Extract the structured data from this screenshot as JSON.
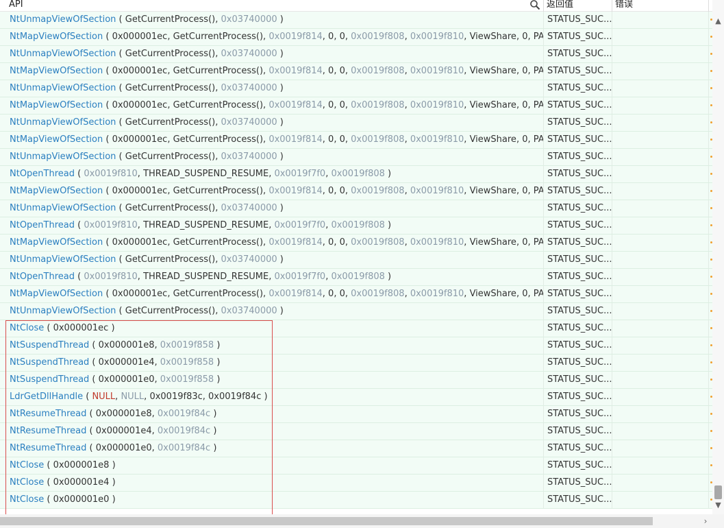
{
  "header": {
    "api_label": "API",
    "return_label": "返回值",
    "error_label": "错误",
    "more_label": "⋮",
    "search_icon": "search-icon"
  },
  "colors": {
    "function": "#2b7fc0",
    "address": "#8a9aa8",
    "null_first": "#c0392b",
    "row_bg": "#f2fcf6",
    "highlight": "#d94c4c"
  },
  "rows": [
    {
      "fn": "NtUnmapViewOfSection",
      "args": [
        {
          "t": "GetCurrentProcess()",
          "k": "plain"
        },
        {
          "t": "0x03740000",
          "k": "addr"
        }
      ],
      "ret": "STATUS_SUC..."
    },
    {
      "fn": "NtMapViewOfSection",
      "args": [
        {
          "t": "0x000001ec",
          "k": "plain"
        },
        {
          "t": "GetCurrentProcess()",
          "k": "plain"
        },
        {
          "t": "0x0019f814",
          "k": "addr"
        },
        {
          "t": "0",
          "k": "plain"
        },
        {
          "t": "0",
          "k": "plain"
        },
        {
          "t": "0x0019f808",
          "k": "addr"
        },
        {
          "t": "0x0019f810",
          "k": "addr"
        },
        {
          "t": "ViewShare",
          "k": "plain"
        },
        {
          "t": "0",
          "k": "plain"
        },
        {
          "t": "PAGE_R...",
          "k": "plain"
        }
      ],
      "ret": "STATUS_SUC...",
      "nocl": true
    },
    {
      "fn": "NtUnmapViewOfSection",
      "args": [
        {
          "t": "GetCurrentProcess()",
          "k": "plain"
        },
        {
          "t": "0x03740000",
          "k": "addr"
        }
      ],
      "ret": "STATUS_SUC..."
    },
    {
      "fn": "NtMapViewOfSection",
      "args": [
        {
          "t": "0x000001ec",
          "k": "plain"
        },
        {
          "t": "GetCurrentProcess()",
          "k": "plain"
        },
        {
          "t": "0x0019f814",
          "k": "addr"
        },
        {
          "t": "0",
          "k": "plain"
        },
        {
          "t": "0",
          "k": "plain"
        },
        {
          "t": "0x0019f808",
          "k": "addr"
        },
        {
          "t": "0x0019f810",
          "k": "addr"
        },
        {
          "t": "ViewShare",
          "k": "plain"
        },
        {
          "t": "0",
          "k": "plain"
        },
        {
          "t": "PAGE_R...",
          "k": "plain"
        }
      ],
      "ret": "STATUS_SUC...",
      "nocl": true
    },
    {
      "fn": "NtUnmapViewOfSection",
      "args": [
        {
          "t": "GetCurrentProcess()",
          "k": "plain"
        },
        {
          "t": "0x03740000",
          "k": "addr"
        }
      ],
      "ret": "STATUS_SUC..."
    },
    {
      "fn": "NtMapViewOfSection",
      "args": [
        {
          "t": "0x000001ec",
          "k": "plain"
        },
        {
          "t": "GetCurrentProcess()",
          "k": "plain"
        },
        {
          "t": "0x0019f814",
          "k": "addr"
        },
        {
          "t": "0",
          "k": "plain"
        },
        {
          "t": "0",
          "k": "plain"
        },
        {
          "t": "0x0019f808",
          "k": "addr"
        },
        {
          "t": "0x0019f810",
          "k": "addr"
        },
        {
          "t": "ViewShare",
          "k": "plain"
        },
        {
          "t": "0",
          "k": "plain"
        },
        {
          "t": "PAGE_R...",
          "k": "plain"
        }
      ],
      "ret": "STATUS_SUC...",
      "nocl": true
    },
    {
      "fn": "NtUnmapViewOfSection",
      "args": [
        {
          "t": "GetCurrentProcess()",
          "k": "plain"
        },
        {
          "t": "0x03740000",
          "k": "addr"
        }
      ],
      "ret": "STATUS_SUC..."
    },
    {
      "fn": "NtMapViewOfSection",
      "args": [
        {
          "t": "0x000001ec",
          "k": "plain"
        },
        {
          "t": "GetCurrentProcess()",
          "k": "plain"
        },
        {
          "t": "0x0019f814",
          "k": "addr"
        },
        {
          "t": "0",
          "k": "plain"
        },
        {
          "t": "0",
          "k": "plain"
        },
        {
          "t": "0x0019f808",
          "k": "addr"
        },
        {
          "t": "0x0019f810",
          "k": "addr"
        },
        {
          "t": "ViewShare",
          "k": "plain"
        },
        {
          "t": "0",
          "k": "plain"
        },
        {
          "t": "PAGE_R...",
          "k": "plain"
        }
      ],
      "ret": "STATUS_SUC...",
      "nocl": true
    },
    {
      "fn": "NtUnmapViewOfSection",
      "args": [
        {
          "t": "GetCurrentProcess()",
          "k": "plain"
        },
        {
          "t": "0x03740000",
          "k": "addr"
        }
      ],
      "ret": "STATUS_SUC..."
    },
    {
      "fn": "NtOpenThread",
      "args": [
        {
          "t": "0x0019f810",
          "k": "addr"
        },
        {
          "t": "THREAD_SUSPEND_RESUME",
          "k": "plain"
        },
        {
          "t": "0x0019f7f0",
          "k": "addr"
        },
        {
          "t": "0x0019f808",
          "k": "addr"
        }
      ],
      "ret": "STATUS_SUC..."
    },
    {
      "fn": "NtMapViewOfSection",
      "args": [
        {
          "t": "0x000001ec",
          "k": "plain"
        },
        {
          "t": "GetCurrentProcess()",
          "k": "plain"
        },
        {
          "t": "0x0019f814",
          "k": "addr"
        },
        {
          "t": "0",
          "k": "plain"
        },
        {
          "t": "0",
          "k": "plain"
        },
        {
          "t": "0x0019f808",
          "k": "addr"
        },
        {
          "t": "0x0019f810",
          "k": "addr"
        },
        {
          "t": "ViewShare",
          "k": "plain"
        },
        {
          "t": "0",
          "k": "plain"
        },
        {
          "t": "PAGE_R...",
          "k": "plain"
        }
      ],
      "ret": "STATUS_SUC...",
      "nocl": true
    },
    {
      "fn": "NtUnmapViewOfSection",
      "args": [
        {
          "t": "GetCurrentProcess()",
          "k": "plain"
        },
        {
          "t": "0x03740000",
          "k": "addr"
        }
      ],
      "ret": "STATUS_SUC..."
    },
    {
      "fn": "NtOpenThread",
      "args": [
        {
          "t": "0x0019f810",
          "k": "addr"
        },
        {
          "t": "THREAD_SUSPEND_RESUME",
          "k": "plain"
        },
        {
          "t": "0x0019f7f0",
          "k": "addr"
        },
        {
          "t": "0x0019f808",
          "k": "addr"
        }
      ],
      "ret": "STATUS_SUC..."
    },
    {
      "fn": "NtMapViewOfSection",
      "args": [
        {
          "t": "0x000001ec",
          "k": "plain"
        },
        {
          "t": "GetCurrentProcess()",
          "k": "plain"
        },
        {
          "t": "0x0019f814",
          "k": "addr"
        },
        {
          "t": "0",
          "k": "plain"
        },
        {
          "t": "0",
          "k": "plain"
        },
        {
          "t": "0x0019f808",
          "k": "addr"
        },
        {
          "t": "0x0019f810",
          "k": "addr"
        },
        {
          "t": "ViewShare",
          "k": "plain"
        },
        {
          "t": "0",
          "k": "plain"
        },
        {
          "t": "PAGE_R...",
          "k": "plain"
        }
      ],
      "ret": "STATUS_SUC...",
      "nocl": true
    },
    {
      "fn": "NtUnmapViewOfSection",
      "args": [
        {
          "t": "GetCurrentProcess()",
          "k": "plain"
        },
        {
          "t": "0x03740000",
          "k": "addr"
        }
      ],
      "ret": "STATUS_SUC..."
    },
    {
      "fn": "NtOpenThread",
      "args": [
        {
          "t": "0x0019f810",
          "k": "addr"
        },
        {
          "t": "THREAD_SUSPEND_RESUME",
          "k": "plain"
        },
        {
          "t": "0x0019f7f0",
          "k": "addr"
        },
        {
          "t": "0x0019f808",
          "k": "addr"
        }
      ],
      "ret": "STATUS_SUC..."
    },
    {
      "fn": "NtMapViewOfSection",
      "args": [
        {
          "t": "0x000001ec",
          "k": "plain"
        },
        {
          "t": "GetCurrentProcess()",
          "k": "plain"
        },
        {
          "t": "0x0019f814",
          "k": "addr"
        },
        {
          "t": "0",
          "k": "plain"
        },
        {
          "t": "0",
          "k": "plain"
        },
        {
          "t": "0x0019f808",
          "k": "addr"
        },
        {
          "t": "0x0019f810",
          "k": "addr"
        },
        {
          "t": "ViewShare",
          "k": "plain"
        },
        {
          "t": "0",
          "k": "plain"
        },
        {
          "t": "PAGE_R...",
          "k": "plain"
        }
      ],
      "ret": "STATUS_SUC...",
      "nocl": true
    },
    {
      "fn": "NtUnmapViewOfSection",
      "args": [
        {
          "t": "GetCurrentProcess()",
          "k": "plain"
        },
        {
          "t": "0x03740000",
          "k": "addr"
        }
      ],
      "ret": "STATUS_SUC..."
    },
    {
      "fn": "NtClose",
      "args": [
        {
          "t": "0x000001ec",
          "k": "plain"
        }
      ],
      "ret": "STATUS_SUC..."
    },
    {
      "fn": "NtSuspendThread",
      "args": [
        {
          "t": "0x000001e8",
          "k": "plain"
        },
        {
          "t": "0x0019f858",
          "k": "addr"
        }
      ],
      "ret": "STATUS_SUC..."
    },
    {
      "fn": "NtSuspendThread",
      "args": [
        {
          "t": "0x000001e4",
          "k": "plain"
        },
        {
          "t": "0x0019f858",
          "k": "addr"
        }
      ],
      "ret": "STATUS_SUC..."
    },
    {
      "fn": "NtSuspendThread",
      "args": [
        {
          "t": "0x000001e0",
          "k": "plain"
        },
        {
          "t": "0x0019f858",
          "k": "addr"
        }
      ],
      "ret": "STATUS_SUC..."
    },
    {
      "fn": "LdrGetDllHandle",
      "args": [
        {
          "t": "NULL",
          "k": "null"
        },
        {
          "t": "NULL",
          "k": "null2"
        },
        {
          "t": "0x0019f83c",
          "k": "plain"
        },
        {
          "t": "0x0019f84c",
          "k": "plain"
        }
      ],
      "ret": "STATUS_SUC..."
    },
    {
      "fn": "NtResumeThread",
      "args": [
        {
          "t": "0x000001e8",
          "k": "plain"
        },
        {
          "t": "0x0019f84c",
          "k": "addr"
        }
      ],
      "ret": "STATUS_SUC..."
    },
    {
      "fn": "NtResumeThread",
      "args": [
        {
          "t": "0x000001e4",
          "k": "plain"
        },
        {
          "t": "0x0019f84c",
          "k": "addr"
        }
      ],
      "ret": "STATUS_SUC..."
    },
    {
      "fn": "NtResumeThread",
      "args": [
        {
          "t": "0x000001e0",
          "k": "plain"
        },
        {
          "t": "0x0019f84c",
          "k": "addr"
        }
      ],
      "ret": "STATUS_SUC..."
    },
    {
      "fn": "NtClose",
      "args": [
        {
          "t": "0x000001e8",
          "k": "plain"
        }
      ],
      "ret": "STATUS_SUC..."
    },
    {
      "fn": "NtClose",
      "args": [
        {
          "t": "0x000001e4",
          "k": "plain"
        }
      ],
      "ret": "STATUS_SUC..."
    },
    {
      "fn": "NtClose",
      "args": [
        {
          "t": "0x000001e0",
          "k": "plain"
        }
      ],
      "ret": "STATUS_SUC..."
    }
  ],
  "scrollbars": {
    "up_arrow": "▲",
    "down_arrow": "▼",
    "right_arrow": "›"
  }
}
